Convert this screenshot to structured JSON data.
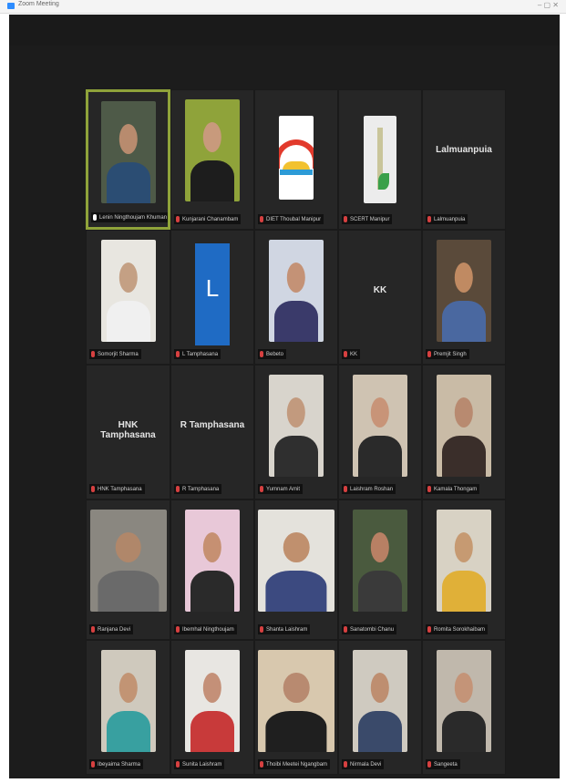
{
  "window": {
    "title": "Zoom Meeting",
    "controls": "– ▢ ✕"
  },
  "participants": [
    {
      "name": "Lenin Ningthoujam Khuman",
      "muted": false,
      "active": true,
      "tile": "video",
      "skin": "#b88b6e",
      "cloth": "#2b4d73",
      "bg": "#4e5a48"
    },
    {
      "name": "Kunjarani Chanambam",
      "muted": true,
      "active": false,
      "tile": "video",
      "skin": "#c89a7c",
      "cloth": "#1d1d1d",
      "bg": "#8fa33a"
    },
    {
      "name": "DIET Thoubal Manipur",
      "muted": true,
      "active": false,
      "tile": "logo"
    },
    {
      "name": "SCERT Manipur",
      "muted": true,
      "active": false,
      "tile": "tower"
    },
    {
      "name": "Lalmuanpuia",
      "muted": true,
      "active": false,
      "tile": "text",
      "text": "Lalmuanpuia"
    },
    {
      "name": "Somorjit Sharma",
      "muted": true,
      "active": false,
      "tile": "video",
      "skin": "#c4a084",
      "cloth": "#f0f0f0",
      "bg": "#e8e6e0"
    },
    {
      "name": "L Tamphasana",
      "muted": true,
      "active": false,
      "tile": "blue",
      "letter": "L"
    },
    {
      "name": "Bebeto",
      "muted": true,
      "active": false,
      "tile": "video",
      "skin": "#c49276",
      "cloth": "#3a3a6a",
      "bg": "#d0d6e2"
    },
    {
      "name": "KK",
      "muted": true,
      "active": false,
      "tile": "text",
      "text": "KK"
    },
    {
      "name": "Premjit Singh",
      "muted": true,
      "active": false,
      "tile": "video",
      "skin": "#c08a62",
      "cloth": "#4a68a0",
      "bg": "#5a4a3a"
    },
    {
      "name": "HNK Tamphasana",
      "muted": true,
      "active": false,
      "tile": "text",
      "text": "HNK Tamphasana"
    },
    {
      "name": "R Tamphasana",
      "muted": true,
      "active": false,
      "tile": "text",
      "text": "R Tamphasana"
    },
    {
      "name": "Yumnam Amit",
      "muted": true,
      "active": false,
      "tile": "video",
      "skin": "#c29a7e",
      "cloth": "#2f2f2f",
      "bg": "#d8d4cc"
    },
    {
      "name": "Laishram Roshan",
      "muted": true,
      "active": false,
      "tile": "video",
      "skin": "#c89478",
      "cloth": "#2a2a2a",
      "bg": "#cfc3b2"
    },
    {
      "name": "Kamala Thongam",
      "muted": true,
      "active": false,
      "tile": "video",
      "skin": "#b88a70",
      "cloth": "#3a2e2a",
      "bg": "#c9bba6"
    },
    {
      "name": "Ranjana Devi",
      "muted": true,
      "active": false,
      "tile": "video",
      "skin": "#b0876a",
      "cloth": "#6a6a6a",
      "bg": "#8a8780",
      "wide": true
    },
    {
      "name": "Ibemhal Ningthoujam",
      "muted": true,
      "active": false,
      "tile": "video",
      "skin": "#c69072",
      "cloth": "#2a2a2a",
      "bg": "#e8c8d8"
    },
    {
      "name": "Shanta Laishram",
      "muted": true,
      "active": false,
      "tile": "video",
      "skin": "#c0906e",
      "cloth": "#3c4a80",
      "bg": "#e4e2dc",
      "wide": true
    },
    {
      "name": "Sanatombi Chanu",
      "muted": true,
      "active": false,
      "tile": "video",
      "skin": "#b88064",
      "cloth": "#3a3a3a",
      "bg": "#4a5a3e"
    },
    {
      "name": "Romita Sorokhaibam",
      "muted": true,
      "active": false,
      "tile": "video",
      "skin": "#c69a72",
      "cloth": "#e0b038",
      "bg": "#d8d2c4"
    },
    {
      "name": "Ibeyaima Sharma",
      "muted": true,
      "active": false,
      "tile": "video",
      "skin": "#c29474",
      "cloth": "#38a0a0",
      "bg": "#cfc9bd"
    },
    {
      "name": "Sunita Laishram",
      "muted": true,
      "active": false,
      "tile": "video",
      "skin": "#c49078",
      "cloth": "#c83a3a",
      "bg": "#e8e6e2"
    },
    {
      "name": "Thoibi Meetei Ngangbam",
      "muted": true,
      "active": false,
      "tile": "video",
      "skin": "#b88a70",
      "cloth": "#1f1f1f",
      "bg": "#d8c8ae",
      "wide": true
    },
    {
      "name": "Nirmala Devi",
      "muted": true,
      "active": false,
      "tile": "video",
      "skin": "#be8e70",
      "cloth": "#3a4a6a",
      "bg": "#cfcac0"
    },
    {
      "name": "Sangeeta",
      "muted": true,
      "active": false,
      "tile": "video",
      "skin": "#c49478",
      "cloth": "#2a2a2a",
      "bg": "#c0b8ac"
    }
  ]
}
